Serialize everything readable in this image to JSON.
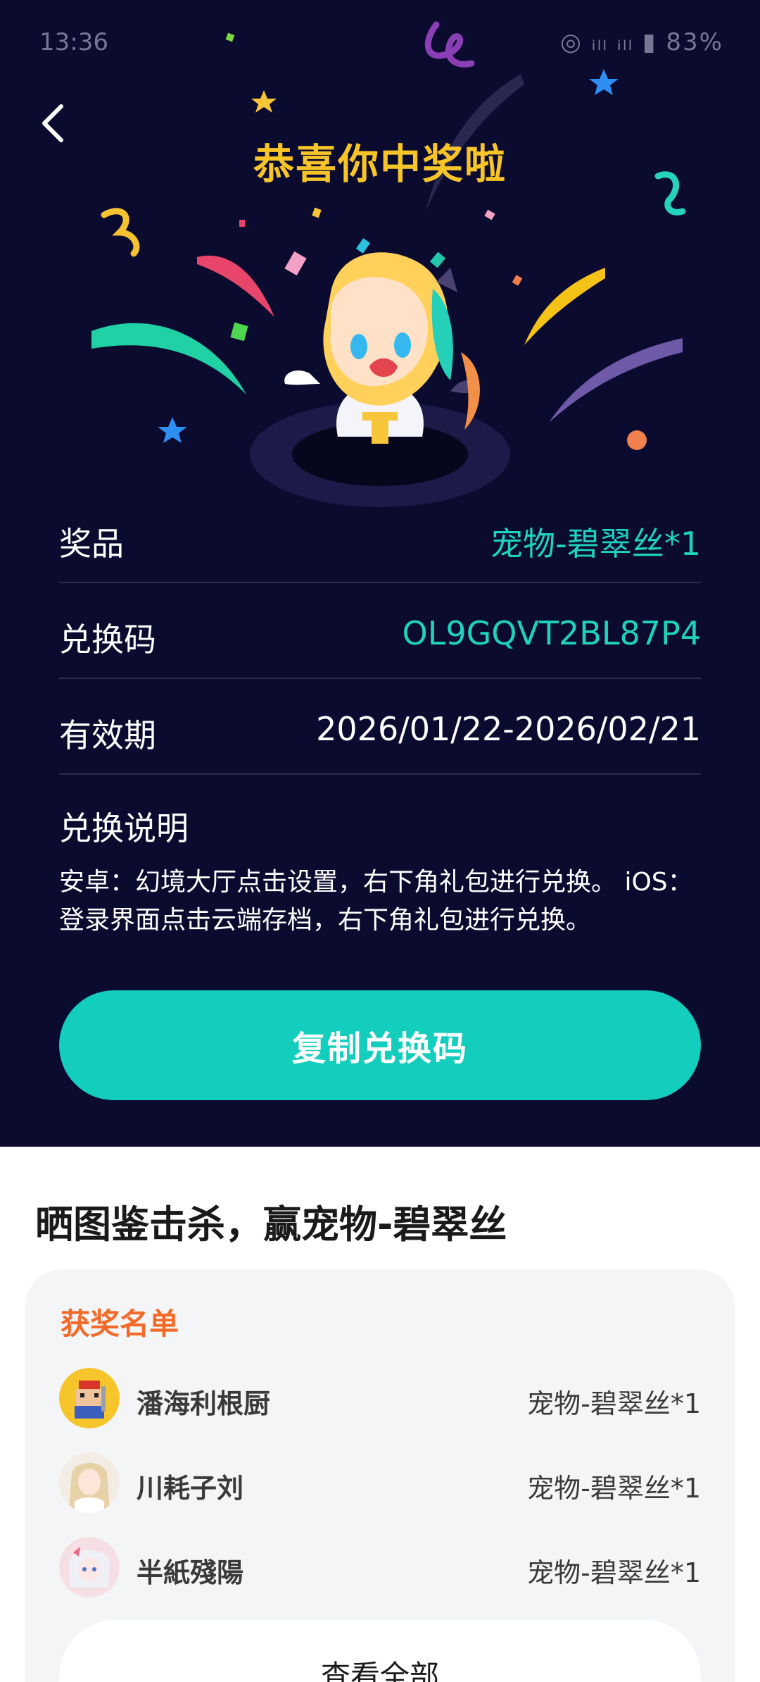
{
  "status_bar": {
    "time": "13:36",
    "indicators": "◎ ᵢₗₗ ᵢₗₗ ▮ 83%"
  },
  "header": {
    "back_icon": "chevron-left-icon",
    "headline": "恭喜你中奖啦"
  },
  "prize_info": {
    "prize_label": "奖品",
    "prize_value": "宠物-碧翠丝*1",
    "code_label": "兑换码",
    "code_value": "OL9GQVT2BL87P4",
    "validity_label": "有效期",
    "validity_value": "2026/01/22-2026/02/21",
    "description_title": "兑换说明",
    "description_text": "安卓：幻境大厅点击设置，右下角礼包进行兑换。 iOS：登录界面点击云端存档，右下角礼包进行兑换。",
    "copy_button_label": "复制兑换码"
  },
  "colors": {
    "hero_bg": "#0b0a2f",
    "headline": "#f7c527",
    "accent": "#1fd2bd",
    "button": "#13cdbd",
    "winners_heading": "#f36b2a"
  },
  "event": {
    "title": "晒图鉴击杀，赢宠物-碧翠丝",
    "winners_heading": "获奖名单",
    "winners": [
      {
        "name": "潘海利根厨",
        "prize": "宠物-碧翠丝*1",
        "avatar": "pixel-knight-avatar"
      },
      {
        "name": "川耗子刘",
        "prize": "宠物-碧翠丝*1",
        "avatar": "anime-girl-blonde-avatar"
      },
      {
        "name": "半紙殘陽",
        "prize": "宠物-碧翠丝*1",
        "avatar": "anime-girl-white-hair-avatar"
      }
    ],
    "view_all_label": "查看全部"
  }
}
